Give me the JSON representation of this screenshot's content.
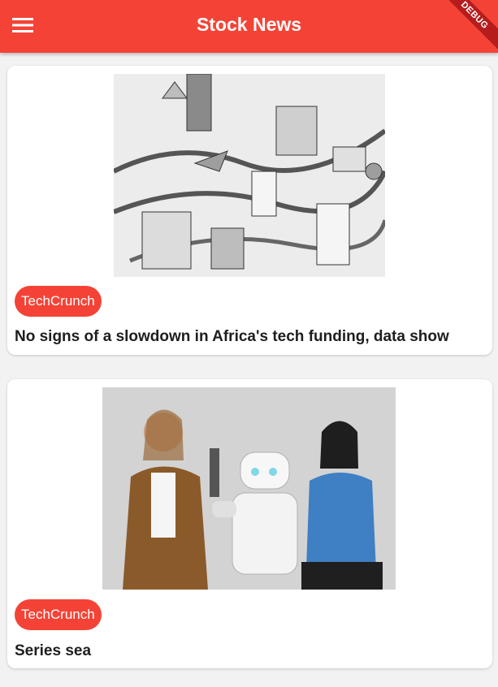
{
  "app_bar": {
    "title": "Stock News",
    "menu_icon": "hamburger-menu-icon",
    "debug_banner": "DEBUG",
    "color": "#f44336"
  },
  "articles": [
    {
      "source": "TechCrunch",
      "headline": "No signs of a slowdown in Africa's tech funding, data show",
      "image": "illustration of an isometric city with skyscrapers, planes, vehicles and stock-chart lines"
    },
    {
      "source": "TechCrunch",
      "headline": "Series sea",
      "image": "photo of two women standing beside a white humanoid service robot"
    }
  ]
}
